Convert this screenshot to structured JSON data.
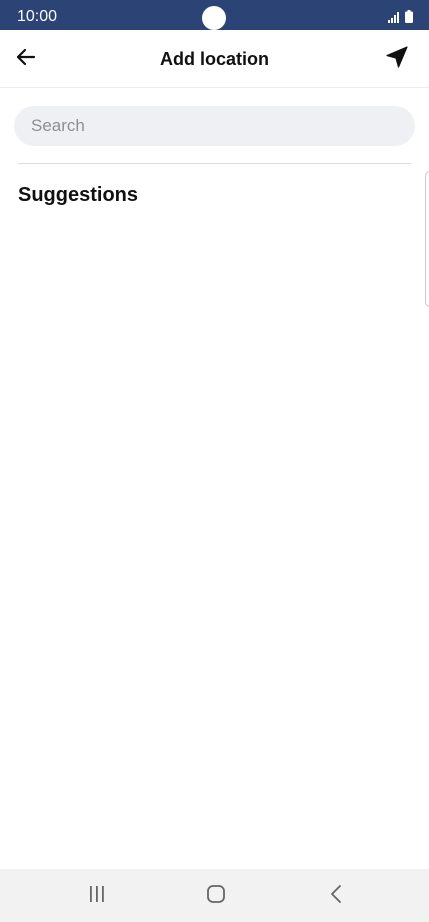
{
  "status_bar": {
    "time": "10:00",
    "icons": [
      "signal-icon",
      "battery-icon"
    ]
  },
  "header": {
    "title": "Add location",
    "back_icon": "arrow-left-icon",
    "location_icon": "navigation-arrow-icon"
  },
  "search": {
    "placeholder": "Search",
    "value": ""
  },
  "suggestions": {
    "title": "Suggestions",
    "items": []
  },
  "nav_bar": {
    "buttons": [
      "recents-icon",
      "home-icon",
      "back-chevron-icon"
    ]
  },
  "colors": {
    "status_bar": "#2c4475",
    "search_background": "#eff0f4",
    "nav_bar": "#f2f2f2"
  }
}
